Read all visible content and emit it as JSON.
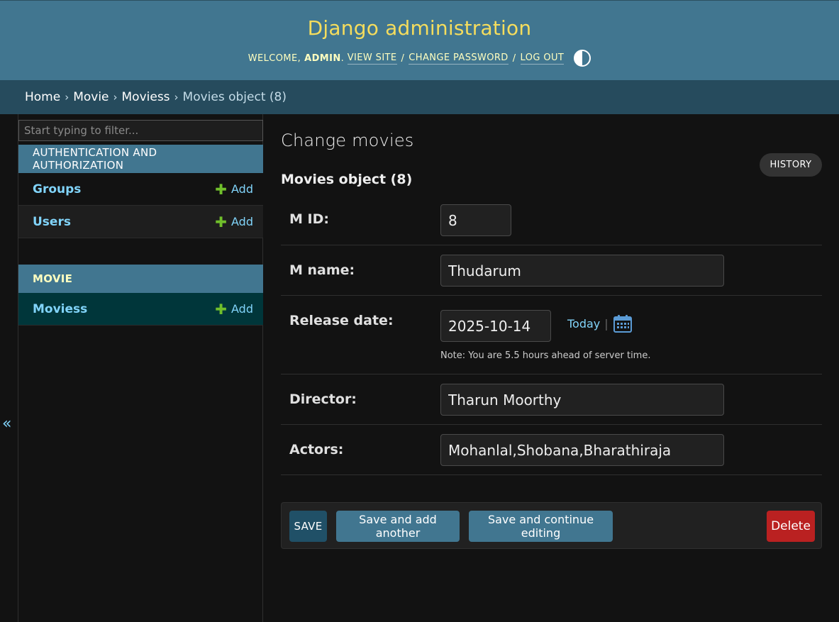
{
  "header": {
    "site_name": "Django administration",
    "welcome": "WELCOME,",
    "username": "ADMIN",
    "view_site": "VIEW SITE",
    "change_password": "CHANGE PASSWORD",
    "log_out": "LOG OUT",
    "separator": "/",
    "theme_toggle_icon": "half-circle-contrast-icon"
  },
  "breadcrumbs": {
    "items": [
      "Home",
      "Movie",
      "Moviess",
      "Movies object (8)"
    ],
    "separator": "›"
  },
  "sidebar": {
    "filter_placeholder": "Start typing to filter...",
    "apps": [
      {
        "caption": "AUTHENTICATION AND AUTHORIZATION",
        "models": [
          {
            "name": "Groups",
            "add_label": "Add"
          },
          {
            "name": "Users",
            "add_label": "Add"
          }
        ]
      },
      {
        "caption": "MOVIE",
        "models": [
          {
            "name": "Moviess",
            "add_label": "Add"
          }
        ]
      }
    ],
    "plus_glyph": "✚",
    "collapse_glyph": "«",
    "colors": {
      "app_header": "#417690",
      "selected_row": "#00363a",
      "link": "#81d4fa",
      "add_plus": "#70bf2b"
    }
  },
  "main": {
    "title": "Change movies",
    "history_label": "HISTORY",
    "object_title": "Movies object (8)",
    "fields": {
      "m_id": {
        "label": "M ID:",
        "value": "8"
      },
      "m_name": {
        "label": "M name:",
        "value": "Thudarum"
      },
      "release_date": {
        "label": "Release date:",
        "value": "2025-10-14",
        "today_label": "Today",
        "shortcut_separator": "|",
        "note": "Note: You are 5.5 hours ahead of server time."
      },
      "director": {
        "label": "Director:",
        "value": "Tharun Moorthy"
      },
      "actors": {
        "label": "Actors:",
        "value": "Mohanlal,Shobana,Bharathiraja"
      }
    },
    "submit": {
      "save": "SAVE",
      "save_add_another": "Save and add another",
      "save_continue": "Save and continue editing",
      "delete": "Delete"
    }
  }
}
